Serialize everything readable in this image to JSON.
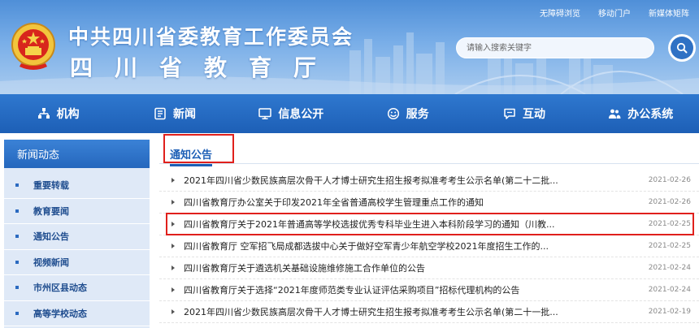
{
  "site": {
    "title": "中共四川省委教育工作委员会",
    "subtitle": "四川省教育厅"
  },
  "toplinks": [
    {
      "label": "无障碍浏览"
    },
    {
      "label": "移动门户"
    },
    {
      "label": "新媒体矩阵"
    }
  ],
  "search": {
    "placeholder": "请输入搜索关键字",
    "icon": "search-icon"
  },
  "nav": [
    {
      "label": "机构",
      "icon": "org-icon"
    },
    {
      "label": "新闻",
      "icon": "news-icon"
    },
    {
      "label": "信息公开",
      "icon": "monitor-icon"
    },
    {
      "label": "服务",
      "icon": "service-icon"
    },
    {
      "label": "互动",
      "icon": "chat-icon"
    },
    {
      "label": "办公系统",
      "icon": "people-icon"
    }
  ],
  "sidebar": {
    "title": "新闻动态",
    "items": [
      {
        "label": "重要转载"
      },
      {
        "label": "教育要闻"
      },
      {
        "label": "通知公告"
      },
      {
        "label": "视频新闻"
      },
      {
        "label": "市州区县动态"
      },
      {
        "label": "高等学校动态"
      }
    ]
  },
  "main": {
    "title": "通知公告",
    "items": [
      {
        "title": "2021年四川省少数民族高层次骨干人才博士研究生招生报考拟准考考生公示名单(第二十二批...",
        "date": "2021-02-26"
      },
      {
        "title": "四川省教育厅办公室关于印发2021年全省普通高校学生管理重点工作的通知",
        "date": "2021-02-26"
      },
      {
        "title": "四川省教育厅关于2021年普通高等学校选拔优秀专科毕业生进入本科阶段学习的通知（川教...",
        "date": "2021-02-25"
      },
      {
        "title": "四川省教育厅 空军招飞局成都选拔中心关于做好空军青少年航空学校2021年度招生工作的...",
        "date": "2021-02-25"
      },
      {
        "title": "四川省教育厅关于遴选机关基础设施维修施工合作单位的公告",
        "date": "2021-02-24"
      },
      {
        "title": "四川省教育厅关于选择“2021年度师范类专业认证评估采购项目”招标代理机构的公告",
        "date": "2021-02-24"
      },
      {
        "title": "2021年四川省少数民族高层次骨干人才博士研究生招生报考拟准考考生公示名单(第二十一批...",
        "date": "2021-02-19"
      }
    ]
  }
}
